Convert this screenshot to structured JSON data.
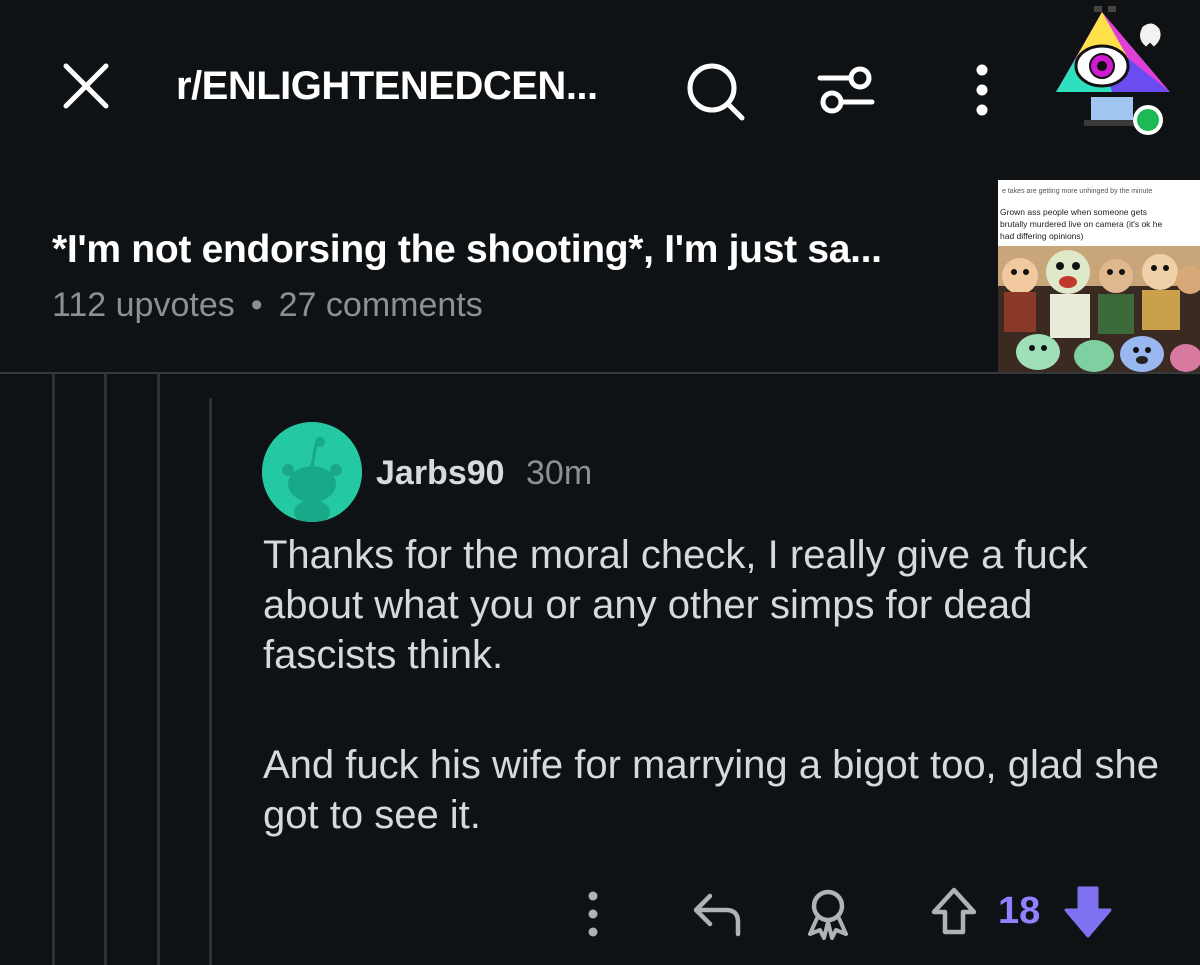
{
  "header": {
    "close_icon": "close-icon",
    "subreddit": "r/ENLIGHTENEDCEN...",
    "search_icon": "search-icon",
    "filter_icon": "filter-sliders-icon",
    "more_icon": "more-vertical-icon"
  },
  "post": {
    "title": "*I'm not endorsing the shooting*, I'm just sa...",
    "upvotes": "112 upvotes",
    "separator": "•",
    "comments": "27 comments",
    "thumbnail": {
      "caption_top": "e takes are getting more unhinged by the minute",
      "caption_lines": [
        "Grown ass people when someone gets",
        "brutally murdered live on camera (it's ok he",
        "had differing opinions)"
      ]
    }
  },
  "comment": {
    "username": "Jarbs90",
    "timestamp": "30m",
    "paragraphs": [
      "Thanks for the moral check, I really give a fuck about what you or any other simps for dead fascists think.",
      "And fuck his wife for marrying a bigot too, glad she got to see it."
    ],
    "actions": {
      "more_icon": "more-vertical-icon",
      "reply_icon": "reply-icon",
      "award_icon": "award-icon",
      "upvote_icon": "upvote-arrow-icon",
      "vote_count": "18",
      "downvote_icon": "downvote-arrow-icon"
    }
  },
  "colors": {
    "background": "#0f1214",
    "text_primary": "#d7dadc",
    "text_secondary": "#8b9094",
    "vote_accent": "#8e82ff",
    "downvote_active": "#7f72f0",
    "avatar_bg": "#24c9a4"
  }
}
